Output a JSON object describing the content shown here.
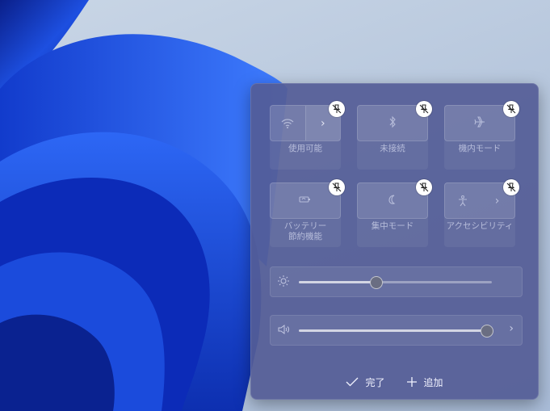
{
  "tiles": [
    {
      "label": "使用可能",
      "icon": "wifi-icon",
      "has_chevron": true
    },
    {
      "label": "未接続",
      "icon": "bluetooth-icon",
      "has_chevron": false
    },
    {
      "label": "機内モード",
      "icon": "airplane-icon",
      "has_chevron": false
    },
    {
      "label_line1": "バッテリー",
      "label_line2": "節約機能",
      "icon": "battery-saver-icon",
      "has_chevron": false
    },
    {
      "label": "集中モード",
      "icon": "moon-icon",
      "has_chevron": false
    },
    {
      "label": "アクセシビリティ",
      "icon": "accessibility-icon",
      "has_chevron": true
    }
  ],
  "brightness": {
    "icon": "sun-icon",
    "level_percent": 40
  },
  "volume": {
    "icon": "speaker-icon",
    "level_percent": 100,
    "chevron": "›"
  },
  "footer": {
    "done_label": "完了",
    "add_label": "追加"
  },
  "chevron_glyph": "›",
  "colors": {
    "panel": "#545c96",
    "wallpaper_blue": "#1f4fd6"
  }
}
